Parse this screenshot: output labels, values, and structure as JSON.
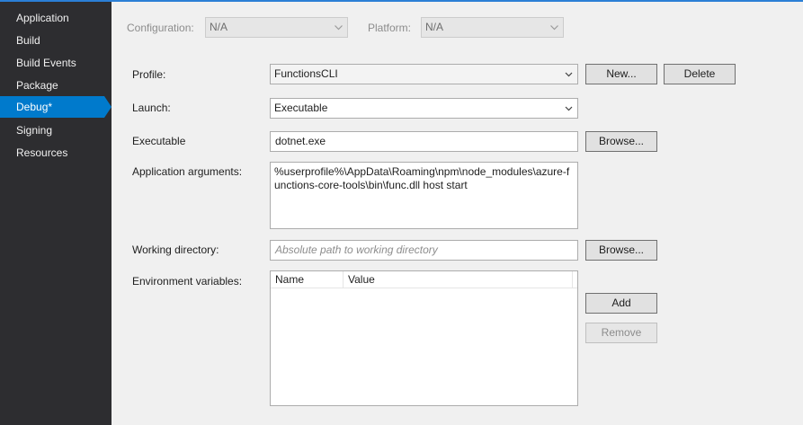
{
  "sidebar": {
    "items": [
      {
        "label": "Application"
      },
      {
        "label": "Build"
      },
      {
        "label": "Build Events"
      },
      {
        "label": "Package"
      },
      {
        "label": "Debug*"
      },
      {
        "label": "Signing"
      },
      {
        "label": "Resources"
      }
    ],
    "active_index": 4
  },
  "top": {
    "configuration_label": "Configuration:",
    "configuration_value": "N/A",
    "platform_label": "Platform:",
    "platform_value": "N/A"
  },
  "form": {
    "profile_label": "Profile:",
    "profile_value": "FunctionsCLI",
    "new_button": "New...",
    "delete_button": "Delete",
    "launch_label": "Launch:",
    "launch_value": "Executable",
    "executable_label": "Executable",
    "executable_value": "dotnet.exe",
    "browse_button": "Browse...",
    "app_args_label": "Application arguments:",
    "app_args_value": "%userprofile%\\AppData\\Roaming\\npm\\node_modules\\azure-functions-core-tools\\bin\\func.dll host start",
    "working_dir_label": "Working directory:",
    "working_dir_placeholder": "Absolute path to working directory",
    "browse_button_2": "Browse...",
    "env_vars_label": "Environment variables:",
    "env_columns": [
      "Name",
      "Value"
    ],
    "add_button": "Add",
    "remove_button": "Remove"
  },
  "colors": {
    "sidebar_bg": "#2d2d30",
    "accent": "#007acc",
    "content_bg": "#f0f0f0"
  },
  "icons": {
    "dropdown": "chevron-down-icon"
  }
}
